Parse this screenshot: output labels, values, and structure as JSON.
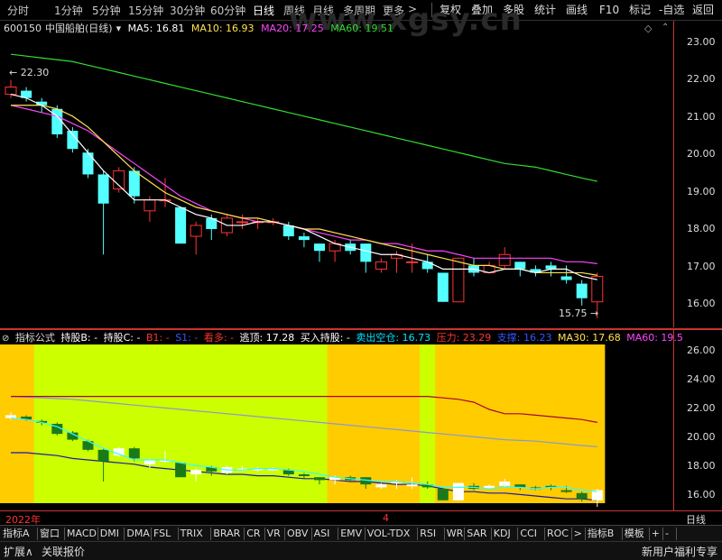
{
  "period_tabs": [
    "分时",
    "1分钟",
    "5分钟",
    "15分钟",
    "30分钟",
    "60分钟",
    "日线",
    "周线",
    "月线",
    "多周期",
    "更多"
  ],
  "more_arrow": ">",
  "right_buttons": [
    "复权",
    "叠加",
    "多股",
    "统计",
    "画线",
    "F10",
    "标记",
    "-自选",
    "返回"
  ],
  "watermark": "www.xgsy.cn",
  "stock": {
    "code": "600150",
    "name": "中国船舶(日线)"
  },
  "ma_header": [
    {
      "label": "MA5: 16.81",
      "color": "#ffffff"
    },
    {
      "label": "MA10: 16.93",
      "color": "#ffe34d"
    },
    {
      "label": "MA20: 17.25",
      "color": "#ff44ff"
    },
    {
      "label": "MA60: 19.51",
      "color": "#33dd33"
    }
  ],
  "price_axis": {
    "min": 15.5,
    "max": 23.5,
    "ticks": [
      "23.00",
      "22.00",
      "21.00",
      "20.00",
      "19.00",
      "18.00",
      "17.00",
      "16.00"
    ]
  },
  "annotations": {
    "high": "22.30",
    "low": "15.75"
  },
  "candles": [
    [
      21.9,
      22.1,
      21.8,
      22.3
    ],
    [
      22.0,
      21.8,
      21.7,
      22.1
    ],
    [
      21.7,
      21.6,
      21.4,
      21.8
    ],
    [
      21.5,
      20.8,
      20.7,
      21.6
    ],
    [
      20.9,
      20.4,
      20.3,
      21.0
    ],
    [
      20.3,
      19.7,
      19.6,
      20.4
    ],
    [
      19.7,
      18.9,
      17.5,
      19.8
    ],
    [
      19.3,
      19.8,
      19.2,
      19.9
    ],
    [
      19.8,
      19.1,
      18.9,
      19.9
    ],
    [
      18.7,
      19.0,
      18.4,
      19.1
    ],
    [
      19.0,
      19.0,
      18.8,
      19.6
    ],
    [
      18.8,
      17.8,
      17.8,
      18.8
    ],
    [
      18.0,
      18.3,
      17.5,
      18.4
    ],
    [
      18.5,
      18.2,
      17.9,
      18.6
    ],
    [
      18.1,
      18.5,
      18.0,
      18.6
    ],
    [
      18.4,
      18.4,
      18.2,
      18.6
    ],
    [
      18.4,
      18.4,
      18.2,
      18.5
    ],
    [
      18.4,
      18.4,
      18.3,
      18.5
    ],
    [
      18.3,
      18.0,
      17.9,
      18.4
    ],
    [
      18.0,
      17.9,
      17.7,
      18.1
    ],
    [
      17.8,
      17.6,
      17.3,
      17.8
    ],
    [
      17.6,
      17.8,
      17.3,
      17.9
    ],
    [
      17.8,
      17.6,
      17.5,
      17.9
    ],
    [
      17.8,
      17.3,
      17.0,
      17.8
    ],
    [
      17.1,
      17.3,
      17.0,
      17.4
    ],
    [
      17.4,
      17.5,
      17.0,
      17.6
    ],
    [
      17.3,
      17.3,
      17.0,
      17.8
    ],
    [
      17.3,
      17.1,
      17.0,
      17.5
    ],
    [
      17.0,
      16.2,
      16.2,
      17.0
    ],
    [
      16.2,
      17.4,
      16.2,
      17.4
    ],
    [
      17.2,
      17.0,
      16.9,
      17.4
    ],
    [
      17.0,
      17.2,
      17.0,
      17.3
    ],
    [
      17.2,
      17.5,
      17.1,
      17.7
    ],
    [
      17.3,
      17.1,
      16.9,
      17.3
    ],
    [
      17.1,
      17.0,
      16.9,
      17.2
    ],
    [
      17.2,
      17.1,
      16.9,
      17.3
    ],
    [
      16.9,
      16.8,
      16.7,
      17.2
    ],
    [
      16.7,
      16.3,
      16.1,
      16.8
    ],
    [
      16.2,
      16.9,
      15.75,
      17.0
    ]
  ],
  "ma_lines": {
    "ma5": [
      21.9,
      21.8,
      21.6,
      21.3,
      20.8,
      20.3,
      19.8,
      19.4,
      19.0,
      19.0,
      19.0,
      18.8,
      18.6,
      18.5,
      18.3,
      18.3,
      18.4,
      18.4,
      18.3,
      18.2,
      18.0,
      17.8,
      17.7,
      17.6,
      17.5,
      17.5,
      17.4,
      17.3,
      17.1,
      17.1,
      17.1,
      17.0,
      17.1,
      17.1,
      17.0,
      17.1,
      17.1,
      16.9,
      16.81
    ],
    "ma10": [
      21.6,
      21.6,
      21.6,
      21.5,
      21.3,
      21.0,
      20.6,
      20.2,
      19.8,
      19.5,
      19.2,
      19.0,
      18.8,
      18.7,
      18.6,
      18.5,
      18.5,
      18.4,
      18.3,
      18.2,
      18.2,
      18.1,
      18.0,
      17.9,
      17.8,
      17.7,
      17.6,
      17.5,
      17.4,
      17.3,
      17.2,
      17.2,
      17.1,
      17.1,
      17.0,
      17.0,
      17.0,
      17.0,
      16.93
    ],
    "ma20": [
      21.6,
      21.5,
      21.4,
      21.3,
      21.1,
      20.9,
      20.6,
      20.3,
      20.0,
      19.7,
      19.4,
      19.1,
      18.9,
      18.7,
      18.6,
      18.5,
      18.4,
      18.4,
      18.3,
      18.2,
      18.1,
      18.0,
      17.9,
      17.9,
      17.8,
      17.8,
      17.7,
      17.6,
      17.6,
      17.5,
      17.4,
      17.4,
      17.4,
      17.4,
      17.4,
      17.4,
      17.3,
      17.3,
      17.25
    ],
    "ma60": [
      23.0,
      22.95,
      22.9,
      22.85,
      22.8,
      22.7,
      22.6,
      22.5,
      22.4,
      22.3,
      22.2,
      22.1,
      22.0,
      21.9,
      21.8,
      21.7,
      21.6,
      21.5,
      21.4,
      21.3,
      21.2,
      21.1,
      21.0,
      20.9,
      20.8,
      20.7,
      20.6,
      20.5,
      20.4,
      20.3,
      20.2,
      20.1,
      20.0,
      19.95,
      19.9,
      19.8,
      19.7,
      19.6,
      19.51
    ]
  },
  "indicator": {
    "formula_label": "指标公式",
    "items": [
      {
        "label": "持股B: -",
        "color": "#ffffff"
      },
      {
        "label": "持股C: -",
        "color": "#ffffff"
      },
      {
        "label": "B1: -",
        "color": "#ff3333"
      },
      {
        "label": "S1: -",
        "color": "#3355ff"
      },
      {
        "label": "看多: -",
        "color": "#ff3333"
      },
      {
        "label": "逃顶: 17.28",
        "color": "#ffffff"
      },
      {
        "label": "买入持股: -",
        "color": "#ffffff"
      },
      {
        "label": "卖出空仓: 16.73",
        "color": "#00e5ff"
      },
      {
        "label": "压力: 23.29",
        "color": "#ff3333"
      },
      {
        "label": "支撑: 16.23",
        "color": "#3355ff"
      },
      {
        "label": "MA30: 17.68",
        "color": "#ffe34d"
      },
      {
        "label": "MA60: 19.5",
        "color": "#ff44ff"
      }
    ],
    "axis": {
      "min": 15.5,
      "max": 27.0,
      "ticks": [
        "26.00",
        "24.00",
        "22.00",
        "20.00",
        "18.00",
        "16.00"
      ]
    },
    "zones": [
      {
        "from": 0,
        "to": 2,
        "color": "#ffcc00"
      },
      {
        "from": 2,
        "to": 21,
        "color": "#ccff00"
      },
      {
        "from": 21,
        "to": 27,
        "color": "#ffcc00"
      },
      {
        "from": 27,
        "to": 28,
        "color": "#ccff00"
      },
      {
        "from": 28,
        "to": 38,
        "color": "#ffcc00"
      }
    ],
    "pressure": [
      23.4,
      23.4,
      23.4,
      23.4,
      23.4,
      23.4,
      23.4,
      23.4,
      23.4,
      23.4,
      23.4,
      23.4,
      23.4,
      23.4,
      23.4,
      23.4,
      23.4,
      23.4,
      23.4,
      23.4,
      23.4,
      23.4,
      23.4,
      23.4,
      23.4,
      23.4,
      23.4,
      23.4,
      23.3,
      23.2,
      23.0,
      22.5,
      22.2,
      22.2,
      22.1,
      22.0,
      21.9,
      21.8,
      21.6
    ],
    "support": [
      19.5,
      19.5,
      19.4,
      19.3,
      19.1,
      19.0,
      18.9,
      18.8,
      18.7,
      18.5,
      18.4,
      18.3,
      18.2,
      18.1,
      18.0,
      18.0,
      17.9,
      17.9,
      17.8,
      17.7,
      17.7,
      17.6,
      17.5,
      17.5,
      17.4,
      17.3,
      17.3,
      17.2,
      17.0,
      16.8,
      16.8,
      16.7,
      16.7,
      16.6,
      16.5,
      16.4,
      16.3,
      16.3,
      16.2
    ]
  },
  "date_axis": {
    "start": "2022年",
    "mark": "4",
    "right": "日线"
  },
  "indicator_tabs": [
    "指标A",
    "窗口",
    "MACD",
    "DMI",
    "DMA",
    "FSL",
    "TRIX",
    "BRAR",
    "CR",
    "VR",
    "OBV",
    "ASI",
    "EMV",
    "VOL-TDX",
    "RSI",
    "WR",
    "SAR",
    "KDJ",
    "CCI",
    "ROC",
    ">",
    "指标B",
    "模板",
    "+",
    "-"
  ],
  "bottom": {
    "expand": "扩展∧",
    "related": "关联报价",
    "promo": "新用户福利专享"
  },
  "colors": {
    "up": "#ff3333",
    "down": "#54ffff",
    "divider": "#cc3333"
  }
}
